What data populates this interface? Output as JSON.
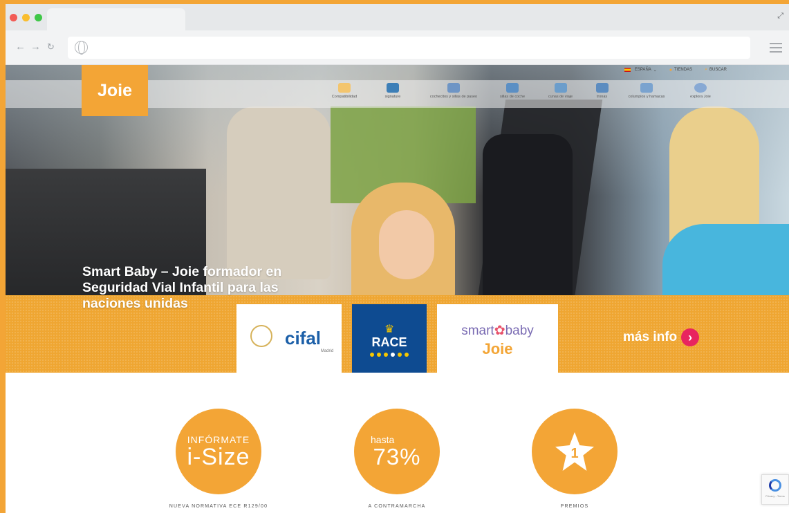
{
  "browser": {
    "url": ""
  },
  "header": {
    "logo": "Joie",
    "top_links": [
      {
        "label": "ESPAÑA",
        "chevron": "⌄"
      },
      {
        "label": "TIENDAS"
      },
      {
        "label": "BUSCAR"
      }
    ],
    "categories": [
      {
        "label": "Compatibilidad",
        "icon": "car-icon"
      },
      {
        "label": "signature",
        "icon": "signature-icon"
      },
      {
        "label": "cochecitos y sillas de paseo",
        "icon": "stroller-icon"
      },
      {
        "label": "sillas de coche",
        "icon": "car-seat-icon"
      },
      {
        "label": "cunas de viaje",
        "icon": "travel-cot-icon"
      },
      {
        "label": "tronas",
        "icon": "highchair-icon"
      },
      {
        "label": "columpios y hamacas",
        "icon": "swing-icon"
      },
      {
        "label": "explora Joie",
        "icon": "heart-icon"
      }
    ]
  },
  "hero": {
    "title": "Smart Baby – Joie formador en Seguridad Vial Infantil para las naciones unidas",
    "partners": {
      "cifal": {
        "word": "cifal",
        "sub": "Madrid"
      },
      "race": {
        "word": "RACE"
      },
      "smartbaby": {
        "line1a": "smart",
        "line1b": "baby",
        "line2": "Joie"
      }
    },
    "cta": "más info"
  },
  "features": [
    {
      "line1": "INFÓRMATE",
      "line2": "i-Size",
      "caption": "NUEVA NORMATIVA ECE R129/00"
    },
    {
      "line1": "hasta",
      "line2": "73%",
      "caption": "A CONTRAMARCHA"
    },
    {
      "line1": "1",
      "caption": "PREMIOS"
    }
  ],
  "recaptcha": {
    "text": "Privacy - Terms"
  },
  "colors": {
    "brand": "#f3a536",
    "cta": "#e8245f",
    "race_blue": "#0e4b91"
  }
}
